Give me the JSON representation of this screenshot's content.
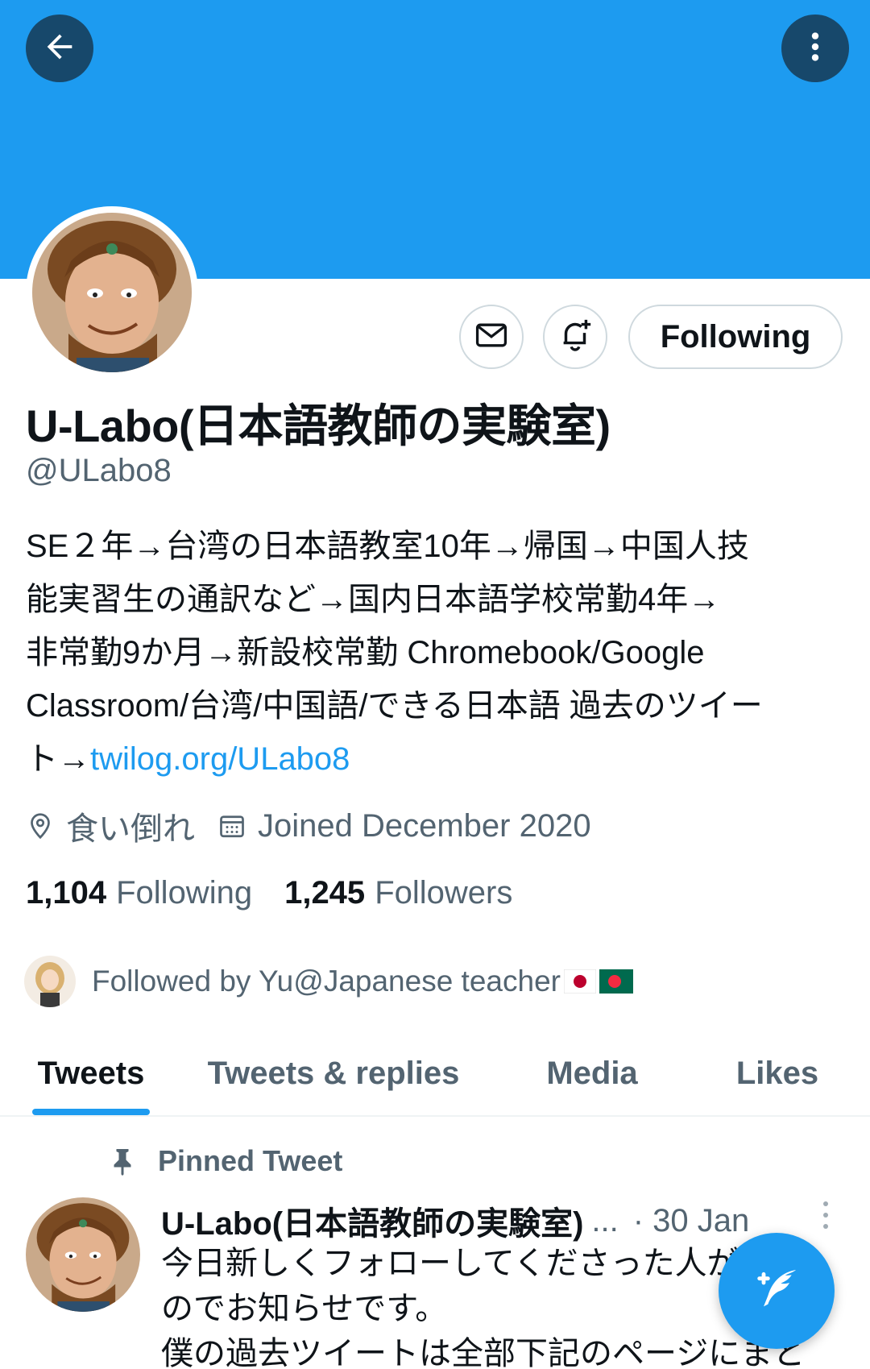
{
  "header": {
    "back_icon": "arrow-left-icon",
    "more_icon": "more-vertical-icon",
    "banner_color": "#1d9bf0"
  },
  "profile": {
    "display_name": "U-Labo(日本語教師の実験室)",
    "handle": "@ULabo8",
    "follow_button_label": "Following",
    "message_icon": "mail-icon",
    "notify_icon": "bell-plus-icon",
    "bio_lines": [
      "SE２年→台湾の日本語教室10年→帰国→中国人技",
      "能実習生の通訳など→国内日本語学校常勤4年→",
      "非常勤9か月→新設校常勤  Chromebook/Google",
      "Classroom/台湾/中国語/できる日本語 過去のツイー"
    ],
    "bio_last_prefix": "ト→",
    "bio_link": "twilog.org/ULabo8",
    "location": "食い倒れ",
    "joined": "Joined December 2020",
    "following_count": "1,104",
    "following_label": "Following",
    "followers_count": "1,245",
    "followers_label": "Followers",
    "followed_by": "Followed by Yu@Japanese teacher"
  },
  "tabs": [
    {
      "label": "Tweets",
      "active": true
    },
    {
      "label": "Tweets & replies",
      "active": false
    },
    {
      "label": "Media",
      "active": false
    },
    {
      "label": "Likes",
      "active": false
    }
  ],
  "pinned_tweet": {
    "pinned_label": "Pinned Tweet",
    "author": "U-Labo(日本語教師の実験室)",
    "author_truncation": "...",
    "date": "· 30 Jan",
    "text_lines": [
      "今日新しくフォローしてくださった人がいる",
      "のでお知らせです。",
      "僕の過去ツイートは全部下記のページにまと"
    ]
  },
  "fab": {
    "icon": "compose-tweet-icon"
  },
  "colors": {
    "accent": "#1d9bf0",
    "dark_button": "#17486b",
    "muted_text": "#536471",
    "border": "#cfd9de"
  }
}
